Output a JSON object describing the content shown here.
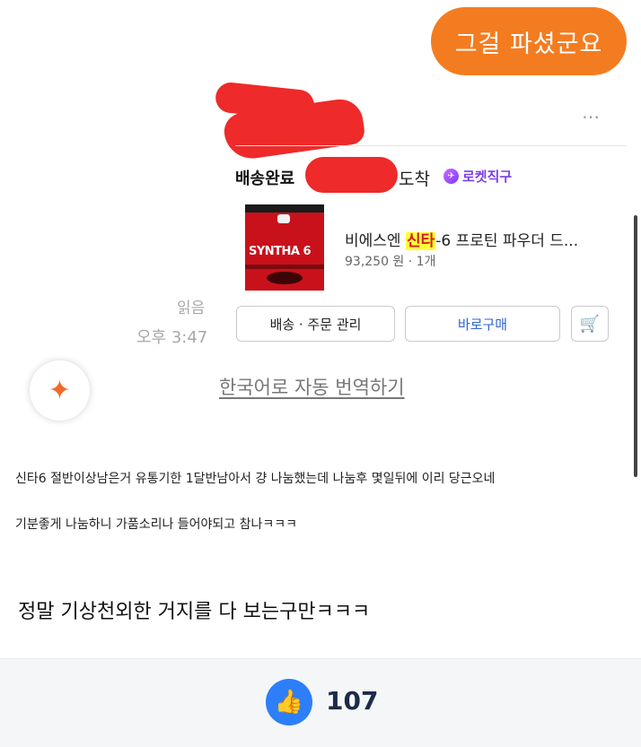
{
  "chat_bubble": {
    "text": "그걸 파셨군요"
  },
  "order_card": {
    "more_icon": "⋯",
    "status": "배송완료",
    "arrival": "도착",
    "rocket_badge": {
      "icon": "rocket-icon",
      "label": "로켓직구"
    },
    "product": {
      "image_brand": "SYNTHA 6",
      "name_prefix": "비에스엔 ",
      "name_highlight": "신타",
      "name_suffix": "-6 프로틴 파우더 드...",
      "price": "93,250 원 · 1개"
    },
    "buttons": {
      "manage": "배송 · 주문 관리",
      "buy_again": "바로구매",
      "cart_icon": "🛒"
    }
  },
  "message_meta": {
    "read": "읽음",
    "time": "오후 3:47"
  },
  "translate": {
    "icon": "✦",
    "link": "한국어로 자동 번역하기"
  },
  "post": {
    "line1": "신타6 절반이상남은거 유통기한 1달반남아서 걍 나눔했는데 나눔후 몇일뒤에 이리 당근오네",
    "line2": "기분좋게 나눔하니 가품소리나 들어야되고 참나ㅋㅋㅋ"
  },
  "reply": {
    "text": "정말 기상천외한 거지를 다 보는구만ㅋㅋㅋ"
  },
  "footer": {
    "like_icon": "👍",
    "like_count": "107"
  },
  "colors": {
    "bubble": "#f47c20",
    "censor": "#ee2a2a",
    "rocket": "#7b3fe4",
    "like": "#2d7ff9",
    "buy": "#2f66d0"
  }
}
